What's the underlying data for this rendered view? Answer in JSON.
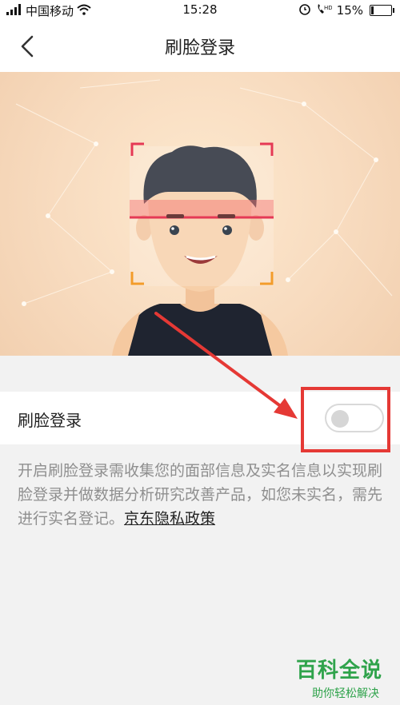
{
  "status_bar": {
    "carrier": "中国移动",
    "time": "15:28",
    "battery_percent_label": "15%",
    "battery_level": 0.15,
    "icons": [
      "signal-icon",
      "wifi-icon",
      "alarm-icon",
      "hd-call-icon",
      "battery-icon"
    ]
  },
  "nav": {
    "title": "刷脸登录",
    "back_icon": "chevron-left-icon"
  },
  "hero": {
    "illustration": "face-scan-illustration",
    "scan_color": "#e53955"
  },
  "face_login_row": {
    "label": "刷脸登录",
    "toggle_on": false
  },
  "description": {
    "text": "开启刷脸登录需收集您的面部信息及实名信息以实现刷脸登录并做数据分析研究改善产品，如您未实名，需先进行实名登记。",
    "privacy_link": "京东隐私政策"
  },
  "annotation": {
    "color": "#e53935"
  },
  "watermark": {
    "logo": "百科全说",
    "tagline": "助你轻松解决"
  }
}
